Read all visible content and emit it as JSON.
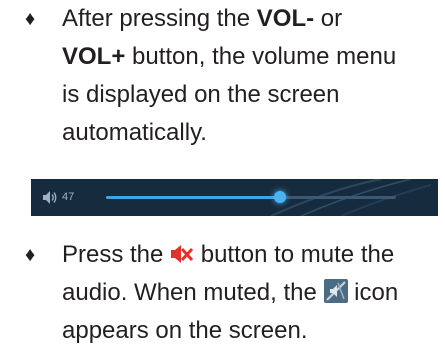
{
  "bullet_symbol": "♦",
  "para1": {
    "line1_text": "After pressing the ",
    "line1_bold": "VOL-",
    "line1_tail": " or",
    "line2_bold": "VOL+",
    "line2_text": " button, the volume menu",
    "line3_text": "is displayed on the screen",
    "line4_text": "automatically."
  },
  "volume_bar": {
    "level_text": "47",
    "level_fraction": 0.6,
    "accent_color": "#3da5e6",
    "background_color": "#172b3e"
  },
  "para2": {
    "line1_before": "Press the ",
    "line1_after": " button to mute the",
    "line2_before": "audio. When muted, the ",
    "line2_after": " icon",
    "line3_text": "appears on the screen.",
    "mute_button_icon": "mute-speaker-icon",
    "muted_indicator_icon": "muted-indicator-icon",
    "mute_button_color": "#e4312b"
  }
}
